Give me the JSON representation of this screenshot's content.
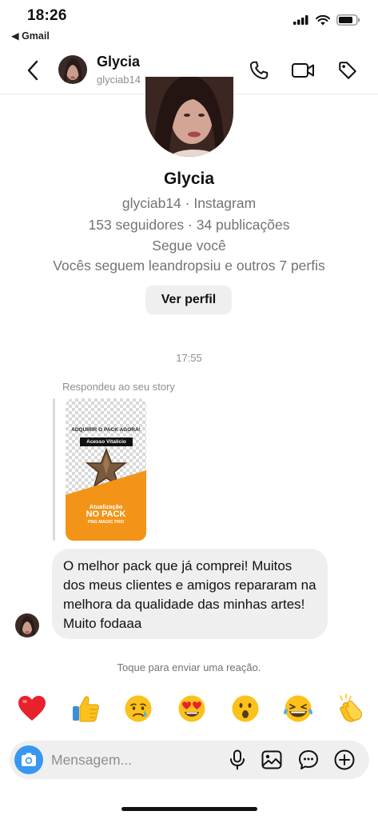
{
  "status_bar": {
    "time": "18:26",
    "back_app": "◀ Gmail"
  },
  "header": {
    "name": "Glycia",
    "handle": "glyciab14",
    "icons": [
      "back-chevron-icon",
      "phone-icon",
      "video-camera-icon",
      "tag-icon"
    ]
  },
  "profile": {
    "name": "Glycia",
    "handle_line": "glyciab14 · Instagram",
    "stats_line": "153 seguidores · 34 publicações",
    "follows_line": "Segue você",
    "mutual_line": "Vocês seguem leandropsiu e outros 7 perfis",
    "view_profile_label": "Ver perfil"
  },
  "thread": {
    "timestamp": "17:55",
    "reply_label": "Respondeu ao seu story",
    "story": {
      "top_text": "ADQUIRIR O PACK AGORA!",
      "badge": "Acesso Vitalício",
      "line1": "Atualização",
      "line2": "NO PACK",
      "line3": "PNG MAGIC PRO"
    },
    "message": "O melhor pack que já comprei! Muitos dos meus clientes e amigos repararam na melhora da qualidade das minhas artes! Muito fodaaa",
    "tap_hint": "Toque para enviar uma reação."
  },
  "reactions": [
    "❤️",
    "👍",
    "😢",
    "😍",
    "😮",
    "😂",
    "👏"
  ],
  "composer": {
    "placeholder": "Mensagem...",
    "icons": [
      "camera-icon",
      "microphone-icon",
      "gallery-icon",
      "sticker-icon",
      "plus-icon"
    ]
  },
  "colors": {
    "accent": "#3897f0",
    "story_orange": "#f39418",
    "bubble": "#efefef"
  }
}
